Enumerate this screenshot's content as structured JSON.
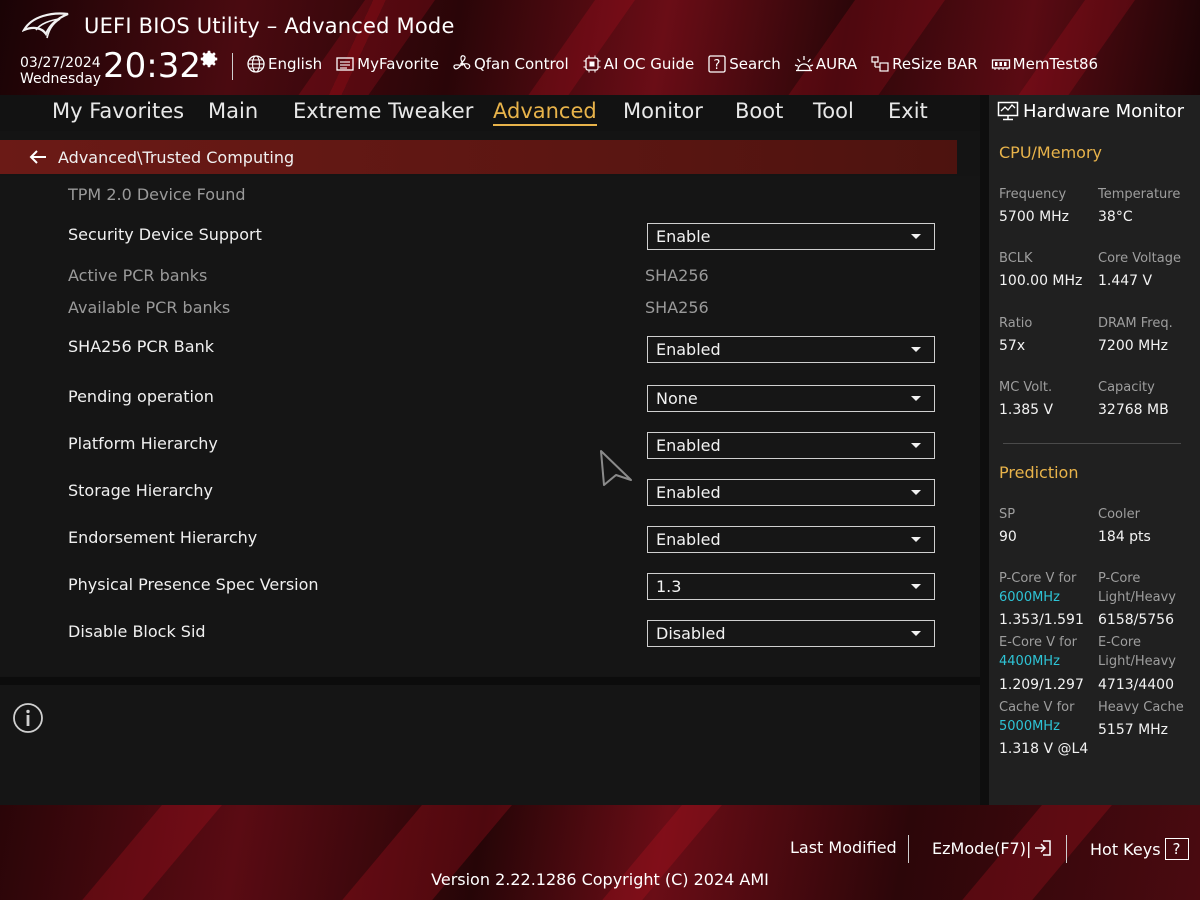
{
  "header": {
    "title": "UEFI BIOS Utility – Advanced Mode",
    "date": "03/27/2024",
    "weekday": "Wednesday",
    "time": "20:32",
    "toolbar": [
      {
        "label": "English",
        "icon": "globe-icon"
      },
      {
        "label": "MyFavorite",
        "icon": "favorite-list-icon"
      },
      {
        "label": "Qfan Control",
        "icon": "fan-icon"
      },
      {
        "label": "AI OC Guide",
        "icon": "ai-oc-icon"
      },
      {
        "label": "Search",
        "icon": "search-help-icon"
      },
      {
        "label": "AURA",
        "icon": "aura-light-icon"
      },
      {
        "label": "ReSize BAR",
        "icon": "resize-bar-icon"
      },
      {
        "label": "MemTest86",
        "icon": "memtest-icon"
      }
    ]
  },
  "tabs": [
    {
      "label": "My Favorites"
    },
    {
      "label": "Main"
    },
    {
      "label": "Extreme Tweaker"
    },
    {
      "label": "Advanced"
    },
    {
      "label": "Monitor"
    },
    {
      "label": "Boot"
    },
    {
      "label": "Tool"
    },
    {
      "label": "Exit"
    }
  ],
  "active_tab": "Advanced",
  "breadcrumb": "Advanced\\Trusted Computing",
  "settings": {
    "tpm_found": "TPM 2.0 Device Found",
    "security_device_support": {
      "label": "Security Device Support",
      "value": "Enable"
    },
    "active_pcr": {
      "label": "Active PCR banks",
      "value": "SHA256"
    },
    "available_pcr": {
      "label": "Available PCR banks",
      "value": "SHA256"
    },
    "sha256_pcr_bank": {
      "label": "SHA256 PCR Bank",
      "value": "Enabled"
    },
    "pending_operation": {
      "label": "Pending operation",
      "value": "None"
    },
    "platform_hierarchy": {
      "label": "Platform Hierarchy",
      "value": "Enabled"
    },
    "storage_hierarchy": {
      "label": "Storage Hierarchy",
      "value": "Enabled"
    },
    "endorsement_hierarchy": {
      "label": "Endorsement Hierarchy",
      "value": "Enabled"
    },
    "pp_spec_version": {
      "label": "Physical Presence Spec Version",
      "value": "1.3"
    },
    "disable_block_sid": {
      "label": "Disable Block Sid",
      "value": "Disabled"
    }
  },
  "hardware_monitor": {
    "title": "Hardware Monitor",
    "cpu_memory_title": "CPU/Memory",
    "frequency": {
      "label": "Frequency",
      "value": "5700 MHz"
    },
    "temperature": {
      "label": "Temperature",
      "value": "38°C"
    },
    "bclk": {
      "label": "BCLK",
      "value": "100.00 MHz"
    },
    "core_voltage": {
      "label": "Core Voltage",
      "value": "1.447 V"
    },
    "ratio": {
      "label": "Ratio",
      "value": "57x"
    },
    "dram_freq": {
      "label": "DRAM Freq.",
      "value": "7200 MHz"
    },
    "mc_volt": {
      "label": "MC Volt.",
      "value": "1.385 V"
    },
    "capacity": {
      "label": "Capacity",
      "value": "32768 MB"
    },
    "prediction_title": "Prediction",
    "sp": {
      "label": "SP",
      "value": "90"
    },
    "cooler": {
      "label": "Cooler",
      "value": "184 pts"
    },
    "pcore_v": {
      "label": "P-Core V for",
      "freq": "6000MHz",
      "value": "1.353/1.591"
    },
    "pcore_lh": {
      "label1": "P-Core",
      "label2": "Light/Heavy",
      "value": "6158/5756"
    },
    "ecore_v": {
      "label": "E-Core V for",
      "freq": "4400MHz",
      "value": "1.209/1.297"
    },
    "ecore_lh": {
      "label1": "E-Core",
      "label2": "Light/Heavy",
      "value": "4713/4400"
    },
    "cache_v": {
      "label": "Cache V for",
      "freq": "5000MHz",
      "value": "1.318 V @L4"
    },
    "heavy_cache": {
      "label": "Heavy Cache",
      "value": "5157 MHz"
    }
  },
  "footer": {
    "last_modified": "Last Modified",
    "ezmode": "EzMode(F7)|",
    "hotkeys": "Hot Keys",
    "hotkeys_key": "?",
    "version": "Version 2.22.1286 Copyright (C) 2024 AMI"
  },
  "colors": {
    "accent": "#e8b34a",
    "freq_highlight": "#2ec4d6",
    "breadcrumb_bg": "#6b1a16"
  }
}
